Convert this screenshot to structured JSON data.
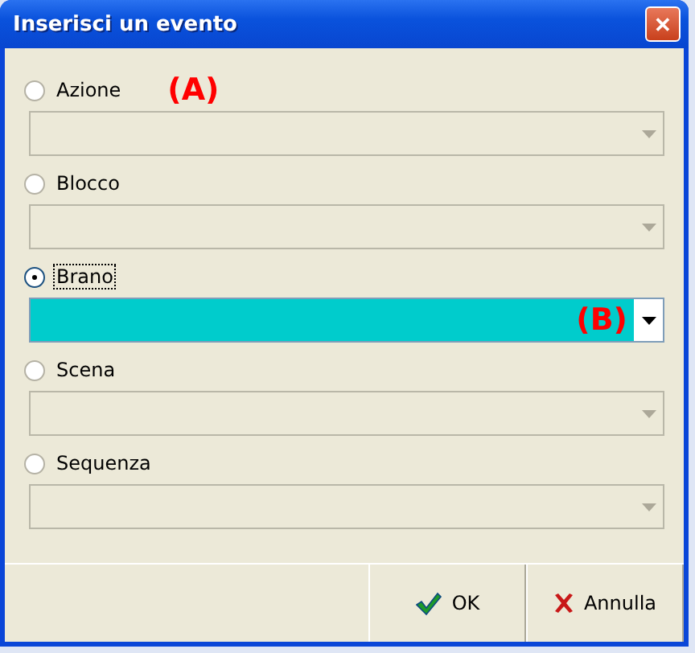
{
  "window": {
    "title": "Inserisci un evento",
    "close": "✕"
  },
  "options": [
    {
      "label": "Azione",
      "selected": false,
      "label_note": "(A)",
      "field": {
        "disabled": true
      }
    },
    {
      "label": "Blocco",
      "selected": false,
      "field": {
        "disabled": true
      }
    },
    {
      "label": "Brano",
      "selected": true,
      "focused": true,
      "field": {
        "disabled": false,
        "note": "(B)"
      }
    },
    {
      "label": "Scena",
      "selected": false,
      "field": {
        "disabled": true
      }
    },
    {
      "label": "Sequenza",
      "selected": false,
      "field": {
        "disabled": true
      }
    }
  ],
  "buttons": [
    {
      "label": "OK",
      "kind": "ok"
    },
    {
      "label": "Annulla",
      "kind": "cancel"
    }
  ]
}
